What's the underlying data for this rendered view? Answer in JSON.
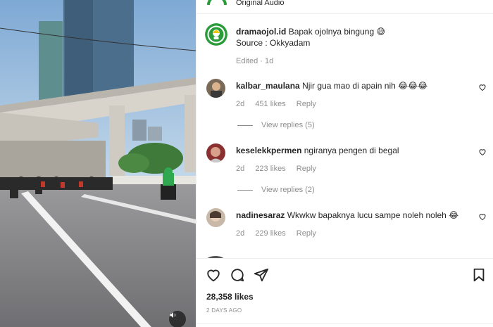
{
  "header": {
    "audio_label": "Original Audio"
  },
  "caption": {
    "username": "dramaojol.id",
    "text": "Bapak ojolnya bingung 😅",
    "source_line": "Source : Okkyadam",
    "edited": "Edited · 1d"
  },
  "comments": [
    {
      "username": "kalbar_maulana",
      "text": "Njir gua mao di apain nih 😂😂😂",
      "age": "2d",
      "likes": "451 likes",
      "reply_label": "Reply",
      "view_replies": "View replies (5)"
    },
    {
      "username": "keselekkpermen",
      "text": "ngiranya pengen di begal",
      "age": "2d",
      "likes": "223 likes",
      "reply_label": "Reply",
      "view_replies": "View replies (2)"
    },
    {
      "username": "nadinesaraz",
      "text": "Wkwkw bapaknya lucu sampe noleh noleh 😂",
      "age": "2d",
      "likes": "229 likes",
      "reply_label": "Reply"
    }
  ],
  "post": {
    "likes": "28,358 likes",
    "date": "2 DAYS AGO"
  },
  "icons": {
    "like": "heart-icon",
    "comment": "comment-icon",
    "share": "paper-plane-icon",
    "save": "bookmark-icon",
    "mute": "speaker-icon"
  },
  "colors": {
    "text": "#262626",
    "secondary": "#8e8e8e",
    "divider": "#efefef",
    "brand_green": "#2a9d3a"
  }
}
